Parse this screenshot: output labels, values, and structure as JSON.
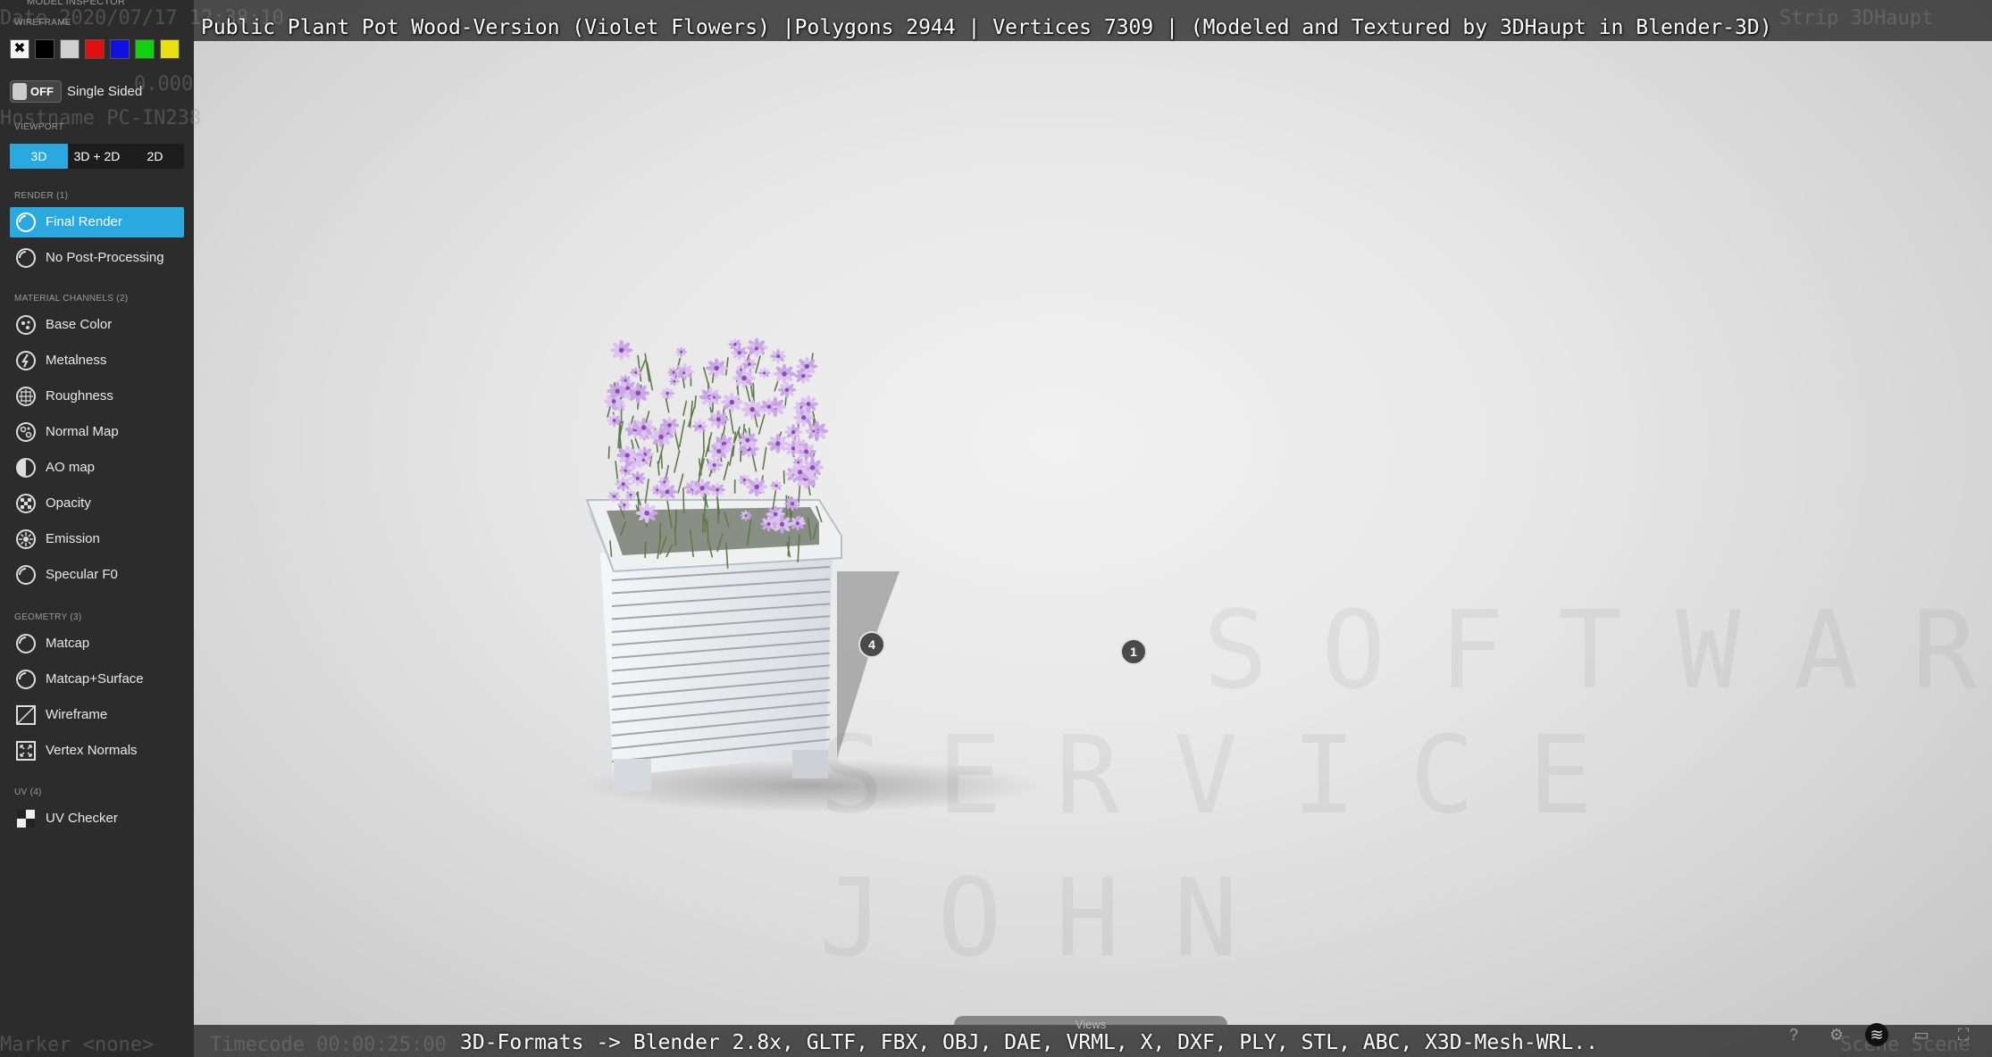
{
  "overlay": {
    "title": "Public Plant Pot Wood-Version (Violet Flowers) |Polygons 2944 | Vertices 7309 | (Modeled and Textured by 3DHaupt in Blender-3D)",
    "formats": "3D-Formats -> Blender 2.8x, GLTF, FBX, OBJ, DAE, VRML, X, DXF, PLY, STL, ABC, X3D-Mesh-WRL..",
    "ghost_date": "Date 2020/07/17 12:38:10",
    "ghost_value": "0.000",
    "ghost_hostname": "Hostname PC-IN238",
    "ghost_strip": "Strip 3DHaupt",
    "ghost_marker": "Marker <none>",
    "ghost_timecode": "Timecode 00:00:25:00",
    "ghost_scene": "Scene Scene"
  },
  "viewport": {
    "watermark_lines": [
      "SOFTWARE",
      "SERVICE",
      "JOHN"
    ],
    "views_tab": "Views",
    "annotations": [
      "4",
      "1"
    ]
  },
  "sidebar": {
    "header": "Model Inspector",
    "wireframe_label": "WIREFRAME",
    "wireframe_colors": [
      "#000000",
      "#cfcfcf",
      "#e01010",
      "#1010e0",
      "#10d010",
      "#e8e010"
    ],
    "single_sided": {
      "state": "OFF",
      "label": "Single Sided"
    },
    "viewport_label": "VIEWPORT",
    "viewport_modes": [
      "3D",
      "3D + 2D",
      "2D"
    ],
    "viewport_active": "3D",
    "render_label": "RENDER (1)",
    "render_items": [
      "Final Render",
      "No Post-Processing"
    ],
    "material_label": "MATERIAL CHANNELS (2)",
    "material_items": [
      "Base Color",
      "Metalness",
      "Roughness",
      "Normal Map",
      "AO map",
      "Opacity",
      "Emission",
      "Specular F0"
    ],
    "geometry_label": "GEOMETRY (3)",
    "geometry_items": [
      "Matcap",
      "Matcap+Surface",
      "Wireframe",
      "Vertex Normals"
    ],
    "uv_label": "UV (4)",
    "uv_items": [
      "UV Checker"
    ]
  },
  "bottom_icons": [
    "help-icon",
    "settings-icon",
    "layers-icon",
    "vr-icon",
    "fullscreen-icon"
  ],
  "colors": {
    "accent": "#29a9e0",
    "sidebar_bg": "#2c2c2c"
  }
}
